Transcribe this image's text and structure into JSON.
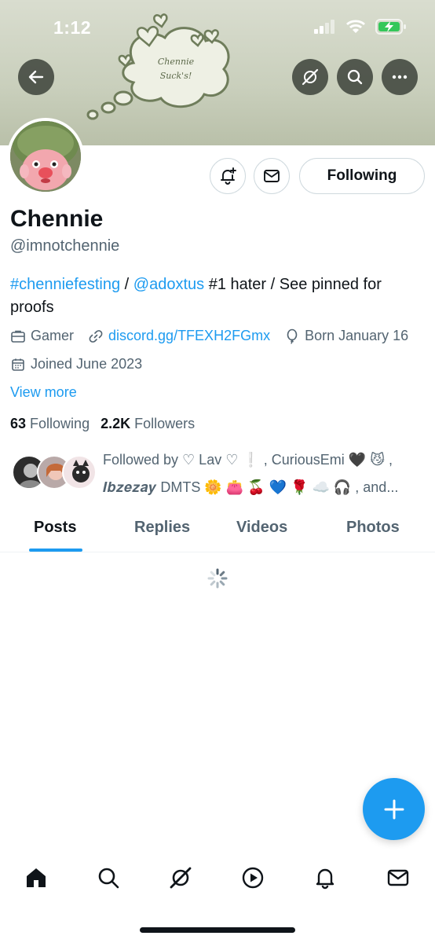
{
  "status_bar": {
    "time": "1:12"
  },
  "banner": {
    "cloud_text_line1": "Chennie",
    "cloud_text_line2": "Suck's!"
  },
  "header_buttons": {
    "back_icon": "arrow-left-icon",
    "grok_icon": "grok-icon",
    "search_icon": "search-icon",
    "more_icon": "more-horizontal-icon"
  },
  "profile": {
    "display_name": "Chennie",
    "handle": "@imnotchennie",
    "bio": {
      "hashtag": "#chenniefesting",
      "sep1": " / ",
      "mention": "@adoxtus",
      "rest": " #1 hater / See pinned for proofs"
    },
    "category": "Gamer",
    "website": "discord.gg/TFEXH2FGmx",
    "birthday": "Born January 16",
    "joined": "Joined June 2023",
    "view_more": "View more",
    "following_count": "63",
    "following_label": "Following",
    "followers_count": "2.2K",
    "followers_label": "Followers"
  },
  "actions": {
    "following_button": "Following"
  },
  "followed_by": {
    "text_line1": "Followed by ♡ Lav ♡ ❕ , CuriousEmi 🖤 😼 ,",
    "name3": "𝑰𝒃𝒛𝒆𝒛𝒂𝒚",
    "text_line2_rest": " DMTS 🌼 👛 🍒 💙 🌹 ☁️ 🎧 , and..."
  },
  "tabs": [
    {
      "label": "Posts",
      "active": true
    },
    {
      "label": "Replies",
      "active": false
    },
    {
      "label": "Videos",
      "active": false
    },
    {
      "label": "Photos",
      "active": false
    }
  ],
  "bottom_nav": [
    "home-icon",
    "search-icon",
    "grok-icon",
    "video-icon",
    "notifications-icon",
    "messages-icon"
  ],
  "colors": {
    "accent": "#1d9bf0",
    "text": "#0f1419",
    "secondary": "#536471",
    "banner": "#c9cfbc"
  }
}
